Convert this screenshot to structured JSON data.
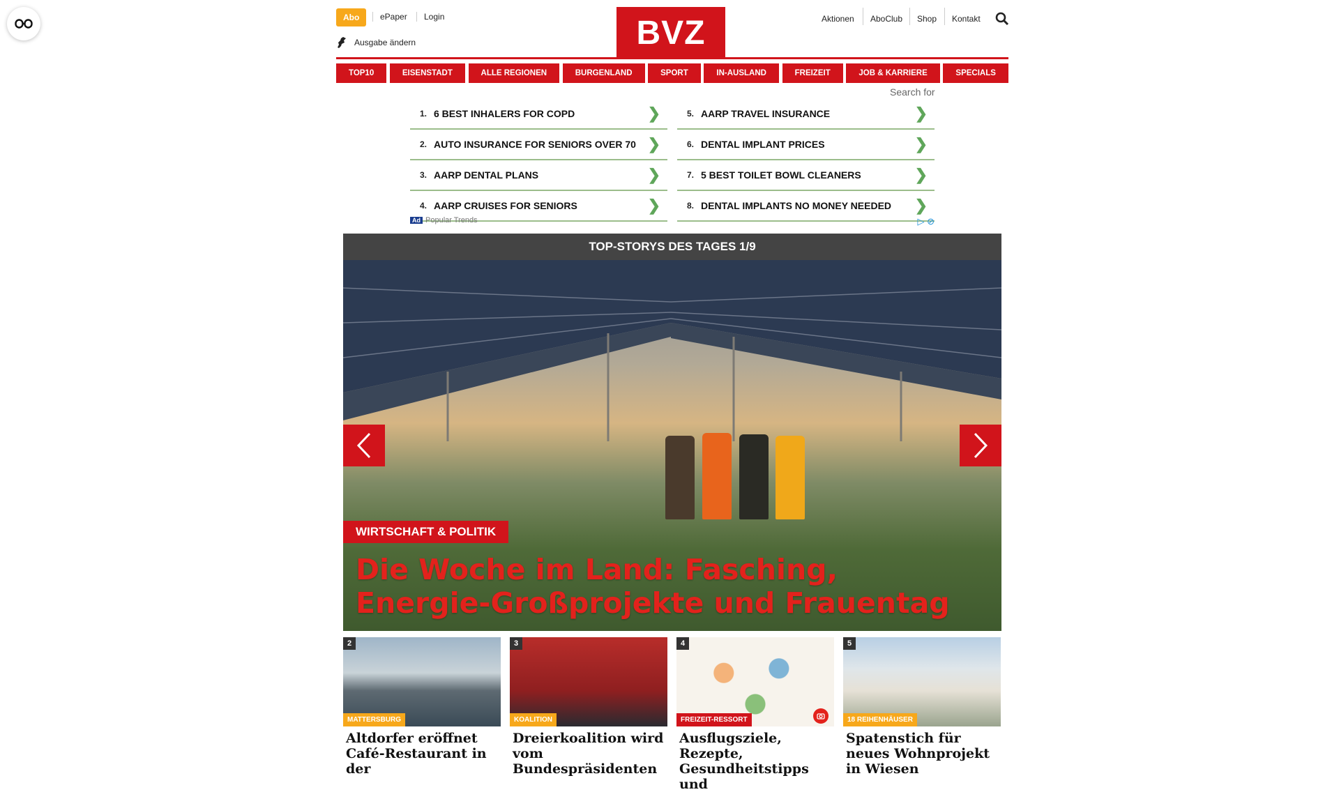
{
  "header": {
    "abo_label": "Abo",
    "epaper_label": "ePaper",
    "login_label": "Login",
    "edition_label": "Ausgabe ändern",
    "logo_text": "BVZ",
    "top_links": [
      "Aktionen",
      "AboClub",
      "Shop",
      "Kontakt"
    ]
  },
  "nav": {
    "items": [
      "TOP10",
      "EISENSTADT",
      "ALLE REGIONEN",
      "BURGENLAND",
      "SPORT",
      "IN-AUSLAND",
      "FREIZEIT",
      "JOB & KARRIERE",
      "SPECIALS"
    ]
  },
  "ad": {
    "search_for": "Search for",
    "left": [
      {
        "num": "1.",
        "text": "6 BEST INHALERS FOR COPD"
      },
      {
        "num": "2.",
        "text": "AUTO INSURANCE FOR SENIORS OVER 70"
      },
      {
        "num": "3.",
        "text": "AARP DENTAL PLANS"
      },
      {
        "num": "4.",
        "text": "AARP CRUISES FOR SENIORS"
      }
    ],
    "right": [
      {
        "num": "5.",
        "text": "AARP TRAVEL INSURANCE"
      },
      {
        "num": "6.",
        "text": "DENTAL IMPLANT PRICES"
      },
      {
        "num": "7.",
        "text": "5 BEST TOILET BOWL CLEANERS"
      },
      {
        "num": "8.",
        "text": "DENTAL IMPLANTS NO MONEY NEEDED"
      }
    ],
    "badge": "Ad",
    "footer": "Popular Trends"
  },
  "topstories": {
    "heading": "TOP-STORYS DES TAGES 1/9",
    "hero_tag": "WIRTSCHAFT & POLITIK",
    "hero_title": "Die Woche im Land: Fasching, Energie-Großprojekte und Frauentag"
  },
  "cards": [
    {
      "num": "2",
      "tag": "MATTERSBURG",
      "tag_color": "#f7a81b",
      "title": "Altdorfer eröffnet Café-Restaurant in der"
    },
    {
      "num": "3",
      "tag": "KOALITION",
      "tag_color": "#f7a81b",
      "title": "Dreierkoalition wird vom Bundespräsidenten"
    },
    {
      "num": "4",
      "tag": "FREIZEIT-RESSORT",
      "tag_color": "#d1141b",
      "title": "Ausflugsziele, Rezepte, Gesundheitstipps und"
    },
    {
      "num": "5",
      "tag": "18 REIHENHÄUSER",
      "tag_color": "#f7a81b",
      "title": "Spatenstich für neues Wohnprojekt in Wiesen"
    }
  ],
  "colors": {
    "brand_red": "#d1141b",
    "abo_orange": "#f7a81b"
  }
}
